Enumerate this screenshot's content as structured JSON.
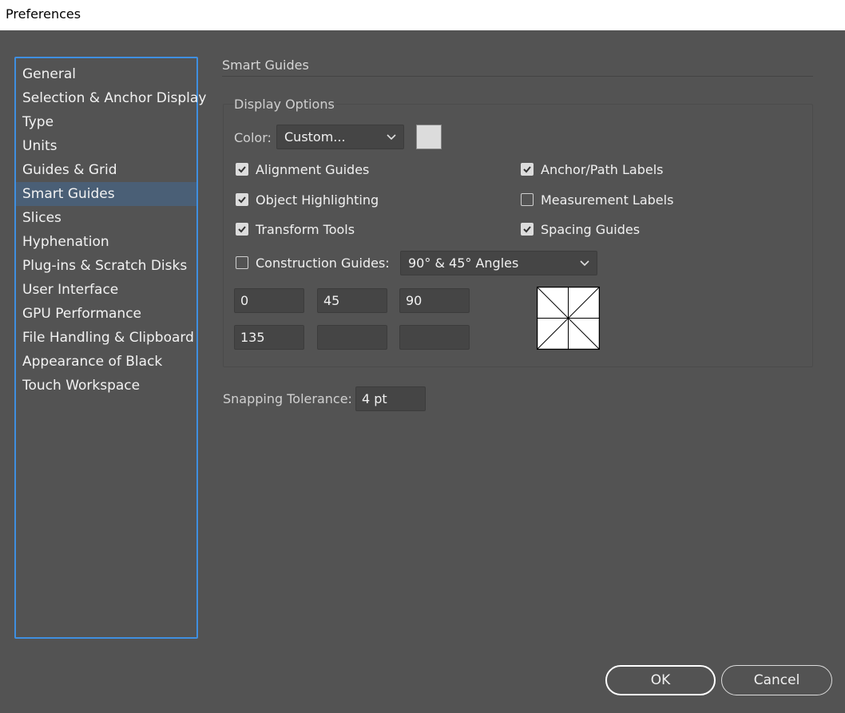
{
  "window": {
    "title": "Preferences"
  },
  "sidebar": {
    "items": [
      {
        "label": "General"
      },
      {
        "label": "Selection & Anchor Display"
      },
      {
        "label": "Type"
      },
      {
        "label": "Units"
      },
      {
        "label": "Guides & Grid"
      },
      {
        "label": "Smart Guides"
      },
      {
        "label": "Slices"
      },
      {
        "label": "Hyphenation"
      },
      {
        "label": "Plug-ins & Scratch Disks"
      },
      {
        "label": "User Interface"
      },
      {
        "label": "GPU Performance"
      },
      {
        "label": "File Handling & Clipboard"
      },
      {
        "label": "Appearance of Black"
      },
      {
        "label": "Touch Workspace"
      }
    ],
    "selected_index": 5,
    "border_color": "#3f8fe0",
    "selected_color": "#4a5f76"
  },
  "main": {
    "section_title": "Smart Guides",
    "display_options": {
      "legend": "Display Options",
      "color_label": "Color:",
      "color_value": "Custom...",
      "swatch_color": "#dcdcdc",
      "checkboxes": {
        "alignment_guides": {
          "label": "Alignment Guides",
          "checked": true
        },
        "object_highlighting": {
          "label": "Object Highlighting",
          "checked": true
        },
        "transform_tools": {
          "label": "Transform Tools",
          "checked": true
        },
        "anchor_path_labels": {
          "label": "Anchor/Path Labels",
          "checked": true
        },
        "measurement_labels": {
          "label": "Measurement Labels",
          "checked": false
        },
        "spacing_guides": {
          "label": "Spacing Guides",
          "checked": true
        },
        "construction_guides": {
          "label": "Construction Guides:",
          "checked": false
        }
      },
      "construction_select": "90° & 45° Angles",
      "angle_fields": [
        "0",
        "45",
        "90",
        "135",
        "",
        ""
      ]
    },
    "snapping": {
      "label": "Snapping Tolerance:",
      "value": "4 pt"
    }
  },
  "buttons": {
    "ok": "OK",
    "cancel": "Cancel"
  }
}
